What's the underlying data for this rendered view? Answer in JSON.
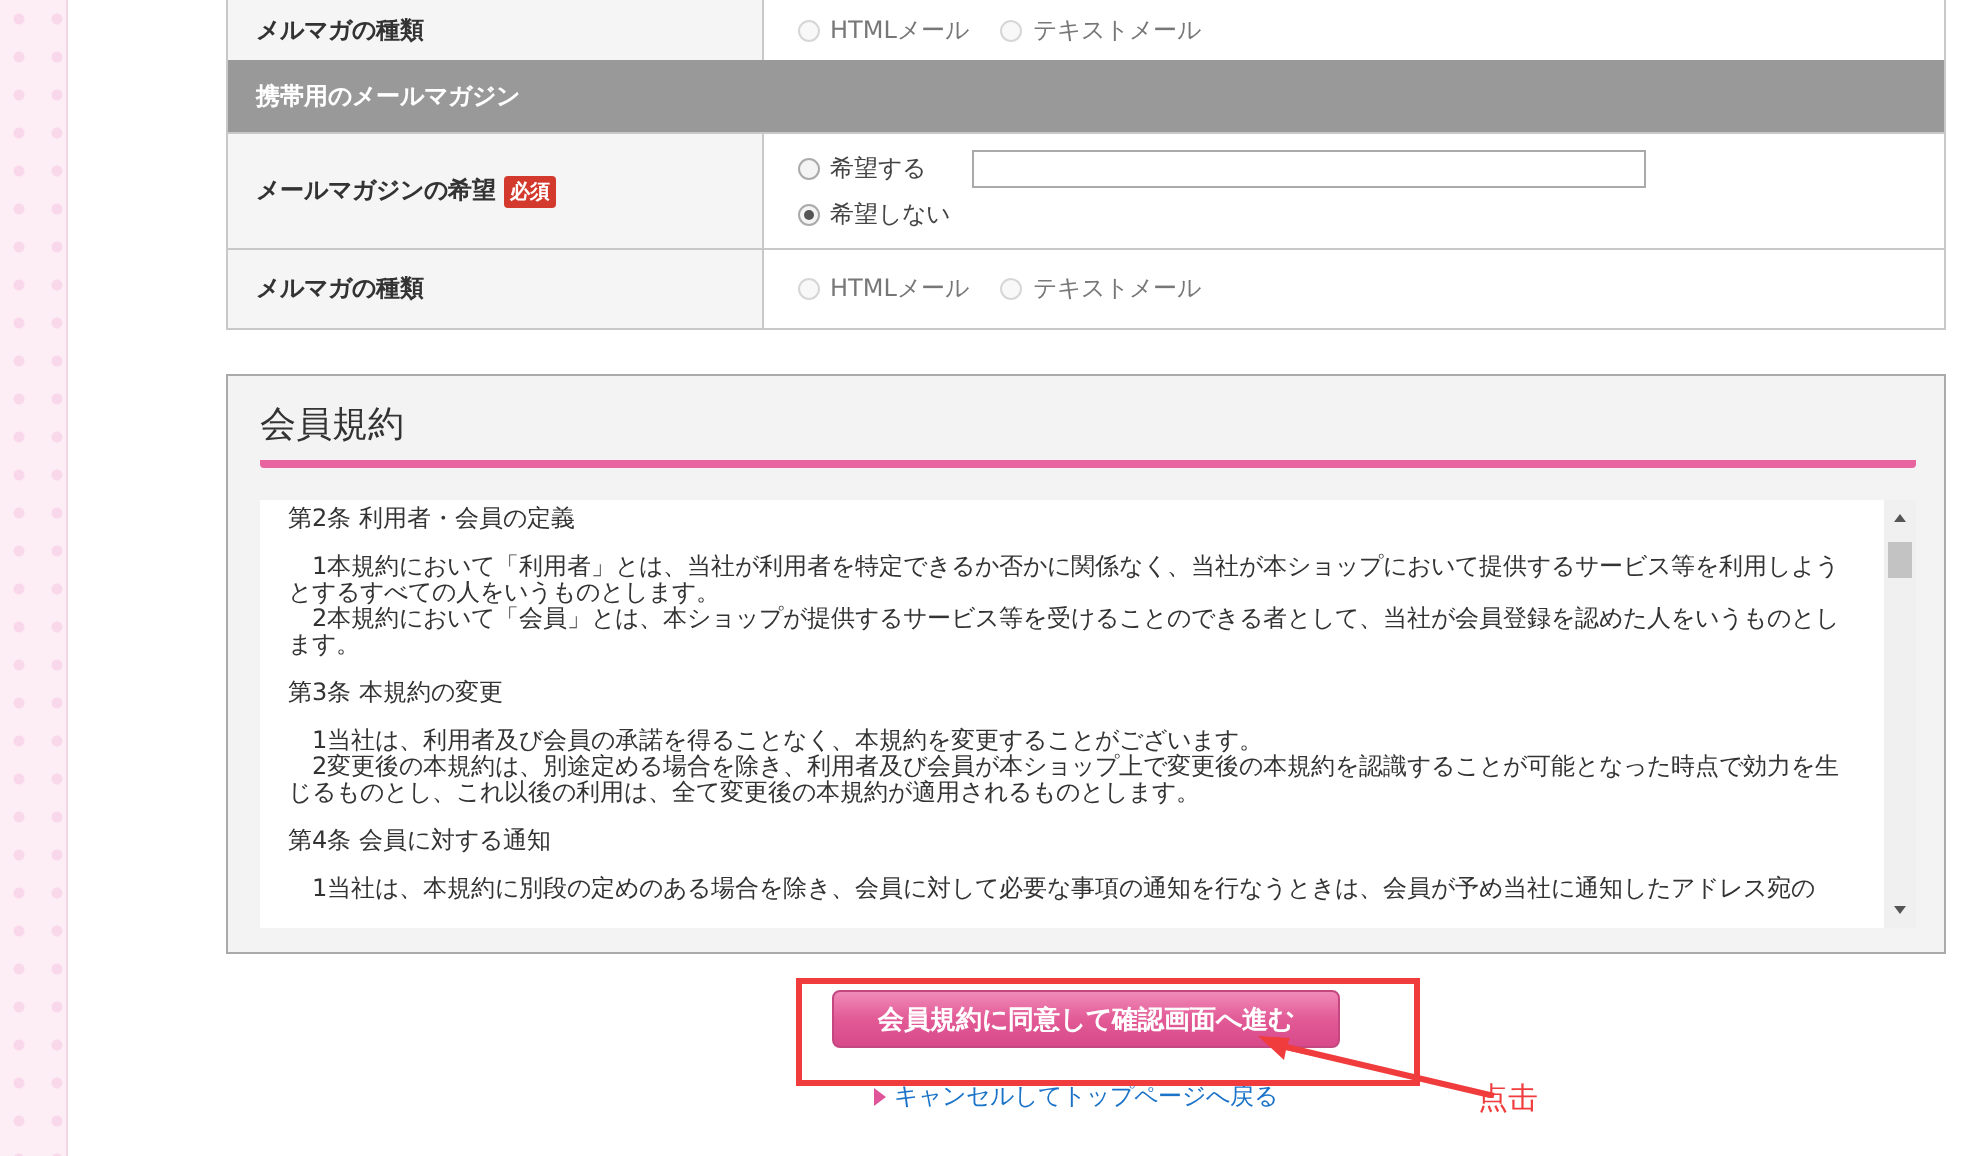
{
  "mail_rows": [
    {
      "kind": "row",
      "label": "メルマガの種類",
      "options": [
        {
          "kind": "plain",
          "label": "HTMLメール",
          "selected": false,
          "disabled": true
        },
        {
          "kind": "plain",
          "label": "テキストメール",
          "selected": false,
          "disabled": true
        }
      ]
    },
    {
      "kind": "header",
      "label": "携帯用のメールマガジン"
    },
    {
      "kind": "row",
      "label": "メールマガジンの希望",
      "badge": "必須",
      "options": [
        {
          "kind": "with_field",
          "label": "希望する",
          "selected": false,
          "disabled": false
        },
        {
          "kind": "plain",
          "label": "希望しない",
          "selected": true,
          "disabled": false
        }
      ]
    },
    {
      "kind": "row",
      "label": "メルマガの種類",
      "options": [
        {
          "kind": "plain",
          "label": "HTMLメール",
          "selected": false,
          "disabled": true
        },
        {
          "kind": "plain",
          "label": "テキストメール",
          "selected": false,
          "disabled": true
        }
      ]
    }
  ],
  "terms": {
    "title": "会員規約",
    "paragraphs": [
      {
        "kind": "heading",
        "text": "第2条 利用者・会員の定義"
      },
      {
        "kind": "body",
        "text": "　1本規約において「利用者」とは、当社が利用者を特定できるか否かに関係なく、当社が本ショップにおいて提供するサービス等を利用しようとするすべての人をいうものとします。"
      },
      {
        "kind": "body",
        "text": "　2本規約において「会員」とは、本ショップが提供するサービス等を受けることのできる者として、当社が会員登録を認めた人をいうものとします。"
      },
      {
        "kind": "heading",
        "text": "第3条 本規約の変更"
      },
      {
        "kind": "body",
        "text": "　1当社は、利用者及び会員の承諾を得ることなく、本規約を変更することがございます。"
      },
      {
        "kind": "body",
        "text": "　2変更後の本規約は、別途定める場合を除き、利用者及び会員が本ショップ上で変更後の本規約を認識することが可能となった時点で効力を生じるものとし、これ以後の利用は、全て変更後の本規約が適用されるものとします。"
      },
      {
        "kind": "heading",
        "text": "第4条 会員に対する通知"
      },
      {
        "kind": "body",
        "text": "　1当社は、本規約に別段の定めのある場合を除き、会員に対して必要な事項の通知を行なうときは、会員が予め当社に通知したアドレス宛の"
      }
    ]
  },
  "submit_button": "会員規約に同意して確認画面へ進む",
  "cancel_link": "キャンセルしてトップページへ戻る",
  "annotation": {
    "label": "点击"
  }
}
